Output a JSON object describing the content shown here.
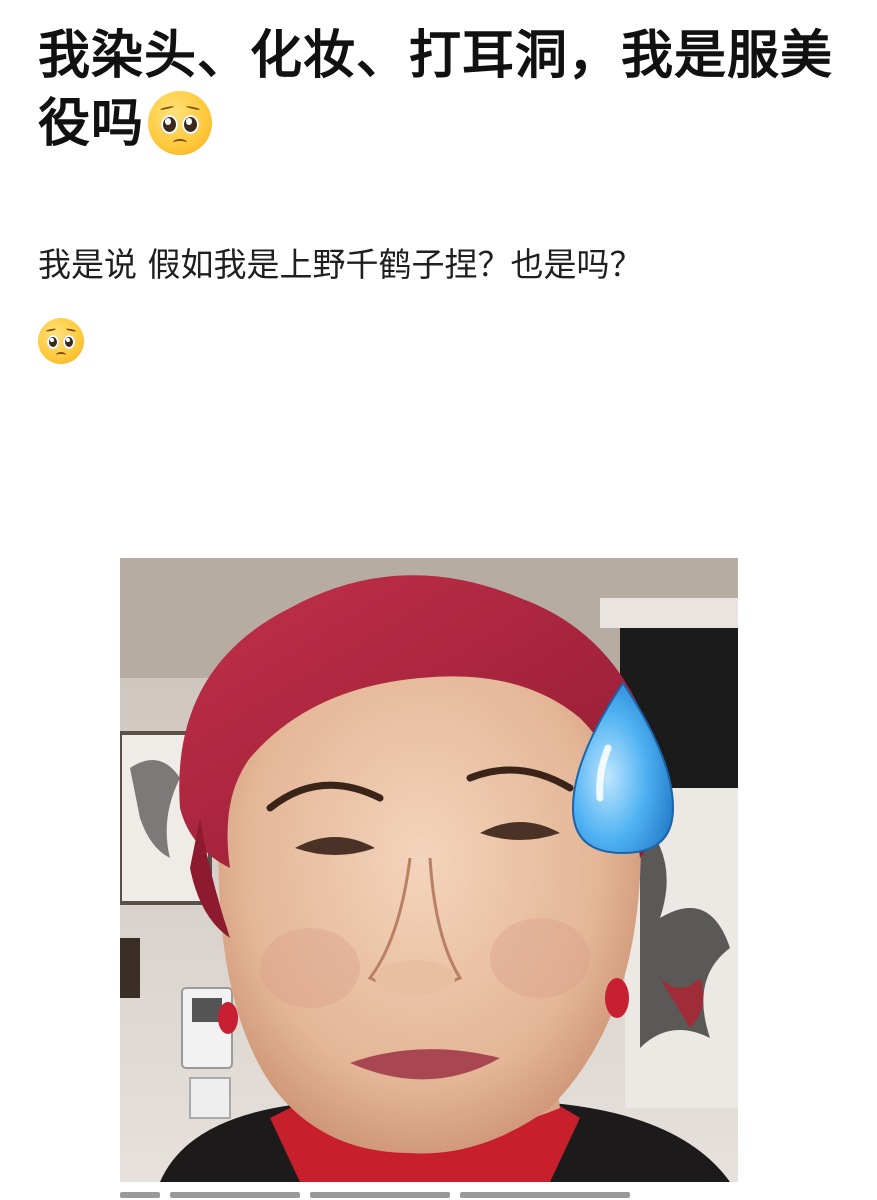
{
  "post": {
    "title": "我染头、化妆、打耳洞，我是服美役吗",
    "title_emoji": "pleading-face-emoji",
    "body": "我是说 假如我是上野千鹤子捏？也是吗？",
    "body_emoji": "pleading-face-emoji"
  },
  "photo": {
    "overlay_icon": "sweat-droplet-icon",
    "hair_color": "#b5263c",
    "skin_color": "#e9c1a4",
    "drop_color": "#3aa0e8"
  },
  "colors": {
    "text": "#111111",
    "background": "#ffffff"
  }
}
